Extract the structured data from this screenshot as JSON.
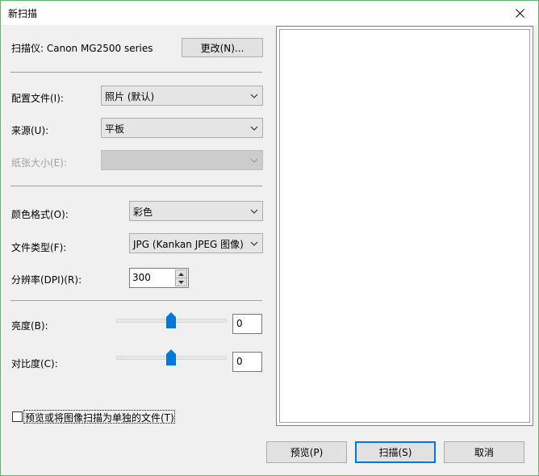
{
  "window": {
    "title": "新扫描"
  },
  "scanner": {
    "label": "扫描仪: Canon MG2500 series",
    "change_button": "更改(N)..."
  },
  "profile": {
    "label": "配置文件(I):",
    "value": "照片 (默认)"
  },
  "source": {
    "label": "来源(U):",
    "value": "平板"
  },
  "paper_size": {
    "label": "纸张大小(E):",
    "value": "",
    "disabled": true
  },
  "color_format": {
    "label": "颜色格式(O):",
    "value": "彩色"
  },
  "file_type": {
    "label": "文件类型(F):",
    "value": "JPG (Kankan JPEG 图像)"
  },
  "resolution": {
    "label": "分辨率(DPI)(R):",
    "value": "300"
  },
  "brightness": {
    "label": "亮度(B):",
    "value": "0"
  },
  "contrast": {
    "label": "对比度(C):",
    "value": "0"
  },
  "separate_files": {
    "label": "预览或将图像扫描为单独的文件(T)",
    "checked": false
  },
  "buttons": {
    "preview": "预览(P)",
    "scan": "扫描(S)",
    "cancel": "取消"
  },
  "colors": {
    "accent": "#0078d7",
    "window_border": "#63b26a"
  }
}
